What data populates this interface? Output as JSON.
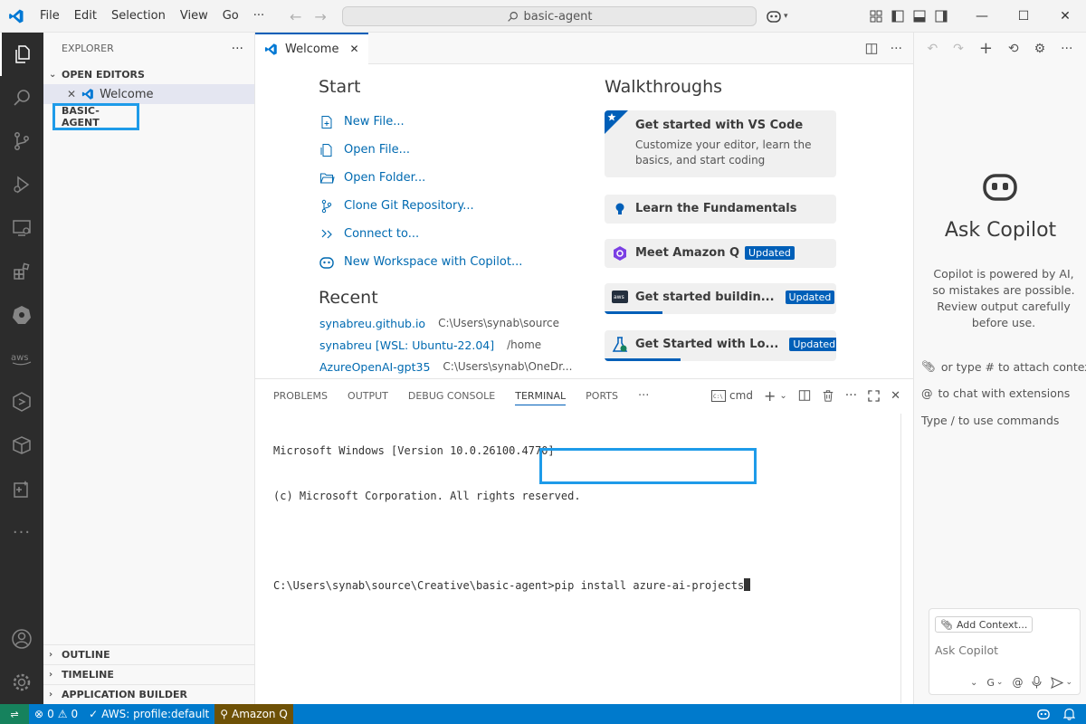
{
  "titlebar": {
    "menu": [
      "File",
      "Edit",
      "Selection",
      "View",
      "Go",
      "···"
    ],
    "search": "basic-agent"
  },
  "sidebar": {
    "title": "EXPLORER",
    "more": "···",
    "open_editors": "OPEN EDITORS",
    "open_editor_item": "Welcome",
    "folder": "BASIC-AGENT",
    "bottom_sections": [
      "OUTLINE",
      "TIMELINE",
      "APPLICATION BUILDER"
    ]
  },
  "editor": {
    "tab": "Welcome",
    "start": {
      "heading": "Start",
      "items": [
        "New File...",
        "Open File...",
        "Open Folder...",
        "Clone Git Repository...",
        "Connect to...",
        "New Workspace with Copilot..."
      ]
    },
    "recent": {
      "heading": "Recent",
      "items": [
        {
          "name": "synabreu.github.io",
          "path": "C:\\Users\\synab\\source"
        },
        {
          "name": "synabreu [WSL: Ubuntu-22.04]",
          "path": "/home"
        },
        {
          "name": "AzureOpenAI-gpt35",
          "path": "C:\\Users\\synab\\OneDr..."
        }
      ]
    },
    "walkthroughs": {
      "heading": "Walkthroughs",
      "items": [
        {
          "title": "Get started with VS Code",
          "desc": "Customize your editor, learn the basics, and start coding",
          "badge": ""
        },
        {
          "title": "Learn the Fundamentals",
          "desc": "",
          "badge": ""
        },
        {
          "title": "Meet Amazon Q",
          "desc": "",
          "badge": "Updated"
        },
        {
          "title": "Get started buildin...",
          "desc": "",
          "badge": "Updated",
          "progress": 0.25
        },
        {
          "title": "Get Started with Lo...",
          "desc": "",
          "badge": "Updated",
          "progress": 0.33
        }
      ]
    }
  },
  "panel": {
    "tabs": [
      "PROBLEMS",
      "OUTPUT",
      "DEBUG CONSOLE",
      "TERMINAL",
      "PORTS",
      "···"
    ],
    "active_tab": "TERMINAL",
    "shell": "cmd",
    "terminal_lines": [
      "Microsoft Windows [Version 10.0.26100.4770]",
      "(c) Microsoft Corporation. All rights reserved.",
      ""
    ],
    "prompt": "C:\\Users\\synab\\source\\Creative\\basic-agent>",
    "command": "pip install azure-ai-projects"
  },
  "chat": {
    "heading": "Ask Copilot",
    "description": "Copilot is powered by AI, so mistakes are possible. Review output carefully before use.",
    "hints": [
      {
        "prefix": "",
        "text": "or type # to attach context"
      },
      {
        "prefix": "@",
        "text": "to chat with extensions"
      },
      {
        "prefix": "",
        "text": "Type / to use commands"
      }
    ],
    "add_context": "Add Context...",
    "input_placeholder": "Ask Copilot",
    "model": "G"
  },
  "statusbar": {
    "problems": "0",
    "warnings": "0",
    "aws": "AWS: profile:default",
    "amazon_q": "Amazon Q"
  },
  "colors": {
    "accent": "#005fb8",
    "statusbar": "#007acc",
    "highlight": "#1e9be9",
    "activitybar": "#2c2c2c"
  }
}
